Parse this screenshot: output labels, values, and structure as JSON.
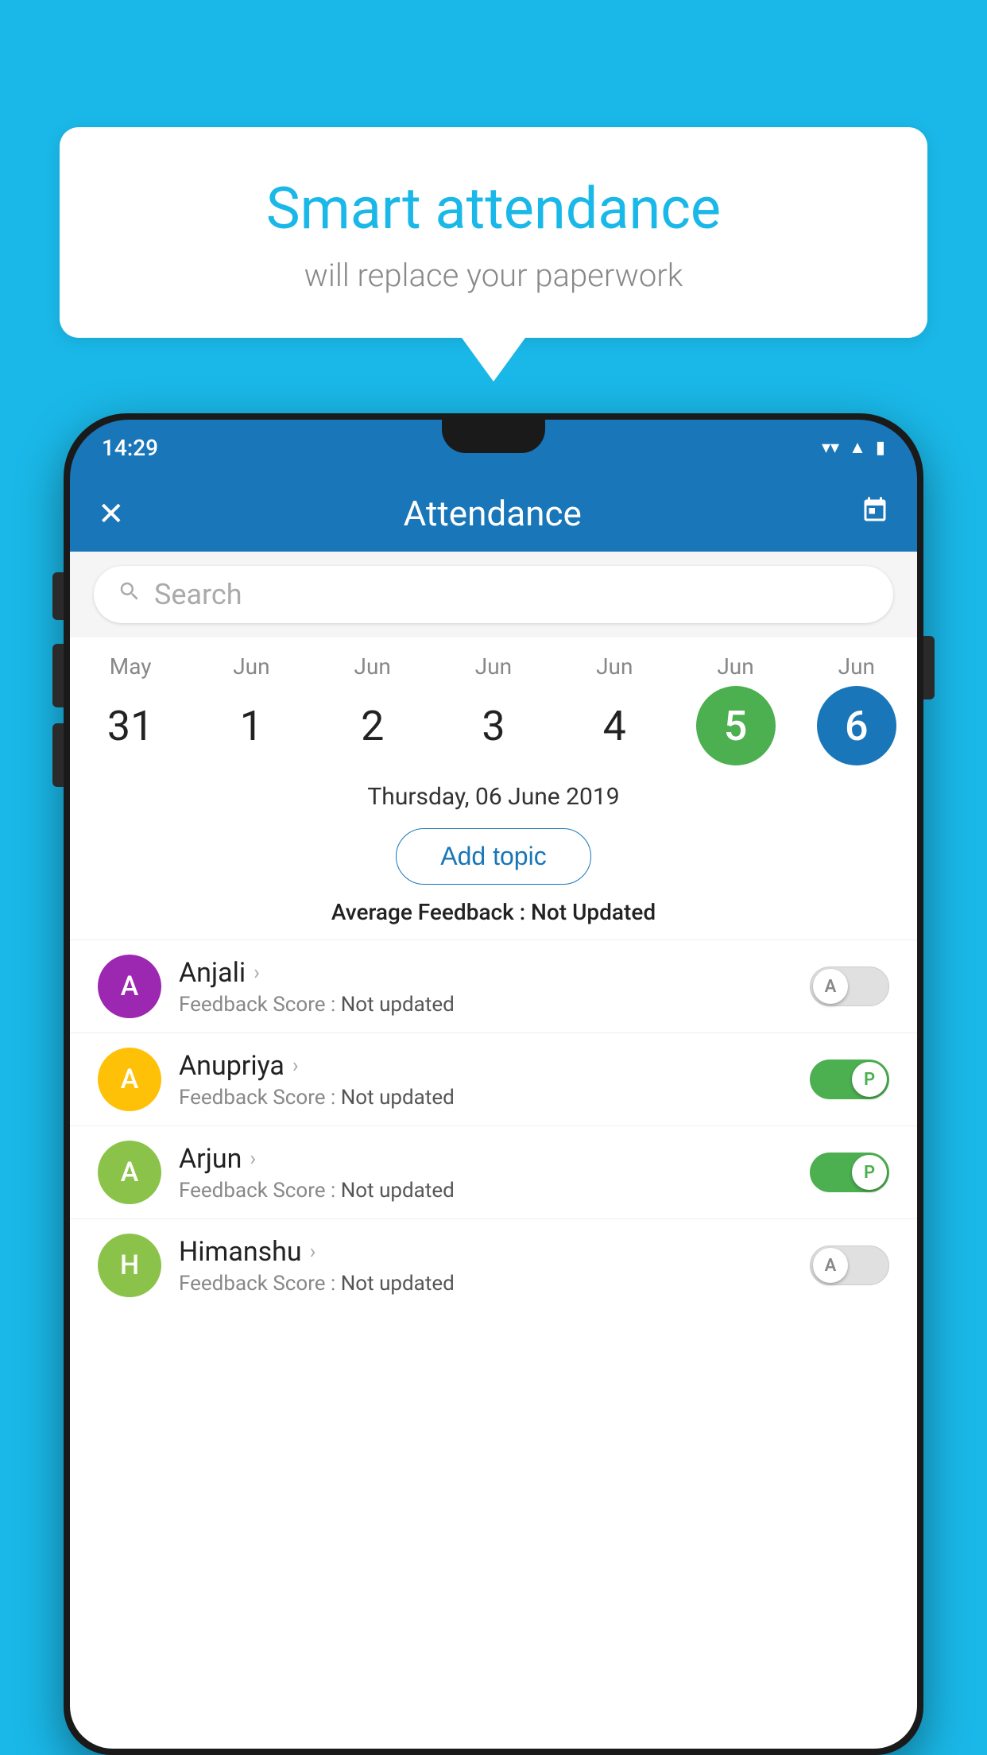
{
  "background_color": "#1ab8e8",
  "speech_bubble": {
    "title": "Smart attendance",
    "subtitle": "will replace your paperwork"
  },
  "status_bar": {
    "time": "14:29",
    "wifi_icon": "▼",
    "signal_icon": "▲",
    "battery_icon": "▮"
  },
  "app_bar": {
    "close_icon": "✕",
    "title": "Attendance",
    "calendar_icon": "📅"
  },
  "search": {
    "placeholder": "Search"
  },
  "dates": [
    {
      "month": "May",
      "day": "31",
      "active": false
    },
    {
      "month": "Jun",
      "day": "1",
      "active": false
    },
    {
      "month": "Jun",
      "day": "2",
      "active": false
    },
    {
      "month": "Jun",
      "day": "3",
      "active": false
    },
    {
      "month": "Jun",
      "day": "4",
      "active": false
    },
    {
      "month": "Jun",
      "day": "5",
      "active": "green"
    },
    {
      "month": "Jun",
      "day": "6",
      "active": "blue"
    }
  ],
  "selected_date_label": "Thursday, 06 June 2019",
  "add_topic_button": "Add topic",
  "average_feedback": {
    "label": "Average Feedback :",
    "value": "Not Updated"
  },
  "students": [
    {
      "name": "Anjali",
      "avatar_letter": "A",
      "avatar_color": "#9c27b0",
      "feedback_label": "Feedback Score :",
      "feedback_value": "Not updated",
      "toggle_state": "off",
      "toggle_label": "A"
    },
    {
      "name": "Anupriya",
      "avatar_letter": "A",
      "avatar_color": "#ffc107",
      "feedback_label": "Feedback Score :",
      "feedback_value": "Not updated",
      "toggle_state": "on",
      "toggle_label": "P"
    },
    {
      "name": "Arjun",
      "avatar_letter": "A",
      "avatar_color": "#8bc34a",
      "feedback_label": "Feedback Score :",
      "feedback_value": "Not updated",
      "toggle_state": "on",
      "toggle_label": "P"
    },
    {
      "name": "Himanshu",
      "avatar_letter": "H",
      "avatar_color": "#8bc34a",
      "feedback_label": "Feedback Score :",
      "feedback_value": "Not updated",
      "toggle_state": "off",
      "toggle_label": "A"
    }
  ]
}
